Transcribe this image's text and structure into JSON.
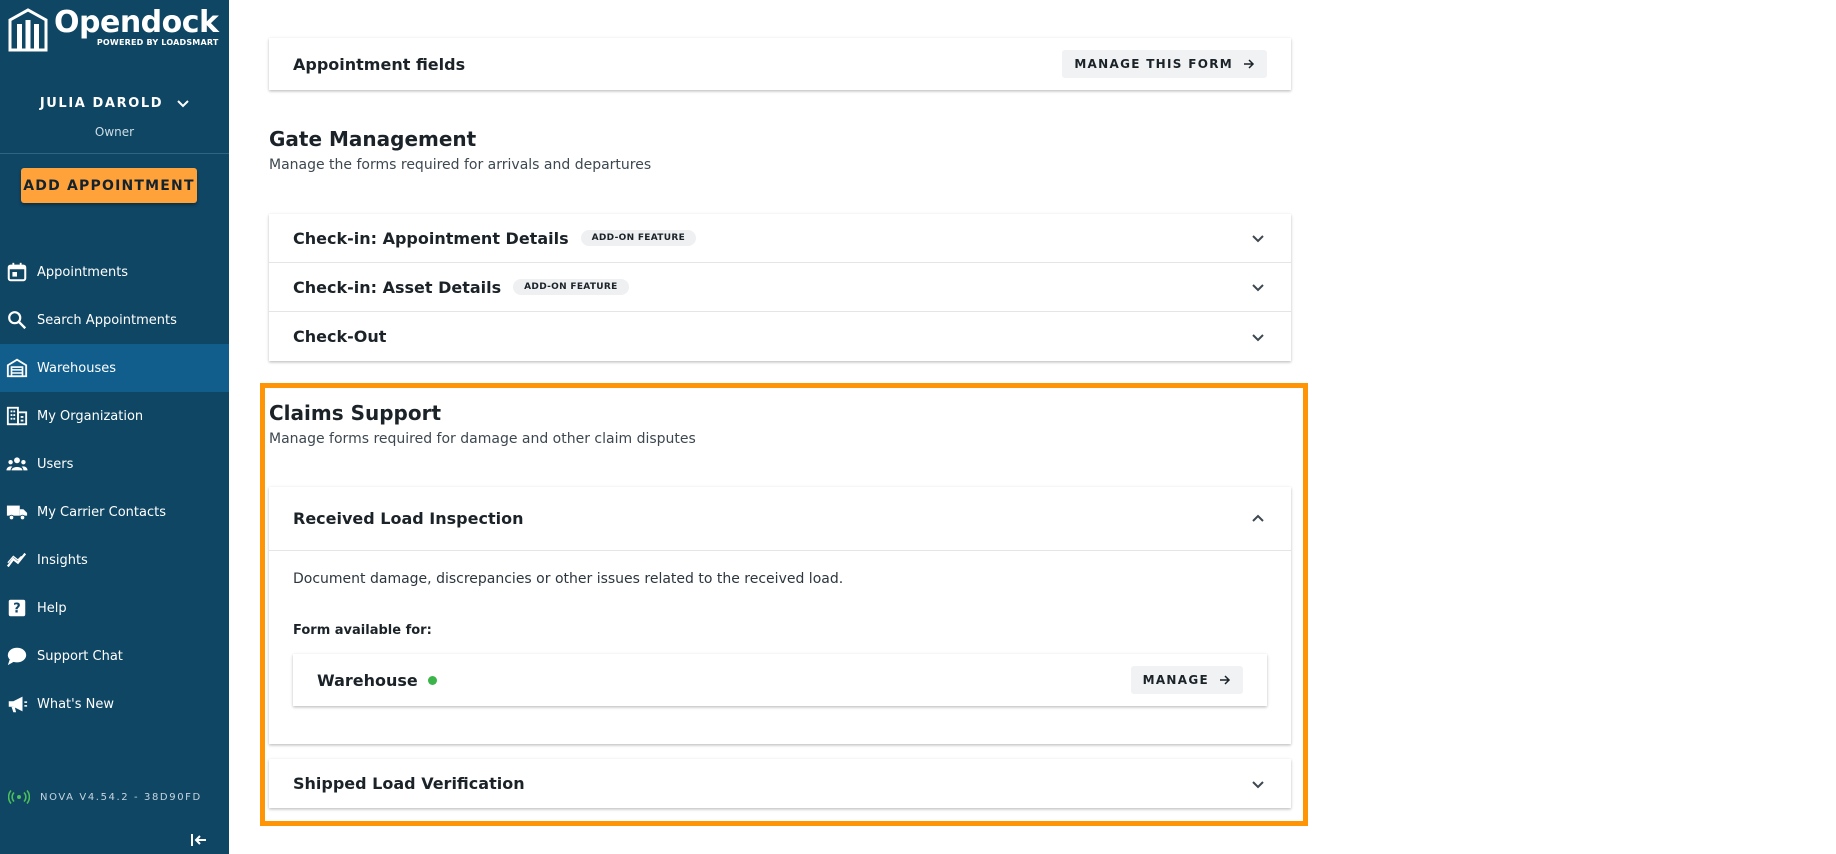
{
  "brand": {
    "name": "Opendock",
    "sub": "POWERED BY LOADSMART"
  },
  "user": {
    "name": "JULIA DAROLD",
    "role": "Owner"
  },
  "add_button": "ADD APPOINTMENT",
  "nav": [
    {
      "label": "Appointments",
      "icon": "calendar-icon"
    },
    {
      "label": "Search Appointments",
      "icon": "search-icon"
    },
    {
      "label": "Warehouses",
      "icon": "warehouse-icon",
      "active": true
    },
    {
      "label": "My Organization",
      "icon": "building-icon"
    },
    {
      "label": "Users",
      "icon": "users-icon"
    },
    {
      "label": "My Carrier Contacts",
      "icon": "truck-icon"
    },
    {
      "label": "Insights",
      "icon": "chart-line-icon"
    },
    {
      "label": "Help",
      "icon": "help-icon"
    },
    {
      "label": "Support Chat",
      "icon": "chat-icon"
    },
    {
      "label": "What's New",
      "icon": "megaphone-icon"
    }
  ],
  "version": "NOVA V4.54.2 - 38D90FD",
  "appointment_fields": {
    "title": "Appointment fields",
    "button": "MANAGE THIS FORM"
  },
  "gate": {
    "title": "Gate Management",
    "subtitle": "Manage the forms required for arrivals and departures",
    "rows": [
      {
        "label": "Check-in: Appointment Details",
        "badge": "ADD-ON FEATURE"
      },
      {
        "label": "Check-in: Asset Details",
        "badge": "ADD-ON FEATURE"
      },
      {
        "label": "Check-Out",
        "badge": ""
      }
    ]
  },
  "claims": {
    "title": "Claims Support",
    "subtitle": "Manage forms required for damage and other claim disputes",
    "received": {
      "title": "Received Load Inspection",
      "description": "Document damage, discrepancies or other issues related to the received load.",
      "available_label": "Form available for:",
      "target": "Warehouse",
      "status_color": "#3bb54a",
      "manage_button": "MANAGE"
    },
    "shipped": {
      "title": "Shipped Load Verification"
    }
  },
  "colors": {
    "sidebar": "#0f4664",
    "active": "#115e8c",
    "accent": "#ffa23a",
    "highlight": "#ff9405"
  }
}
